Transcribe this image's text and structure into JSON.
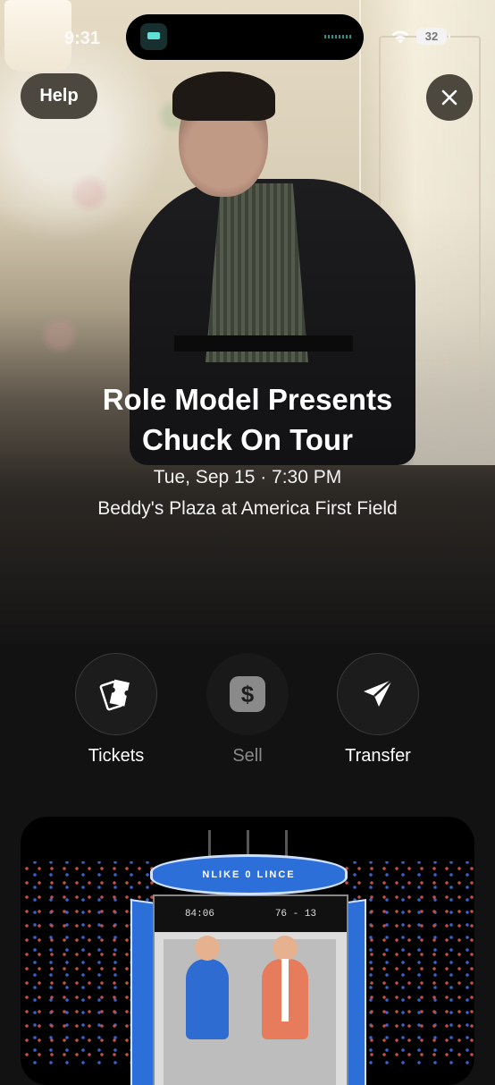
{
  "status_bar": {
    "time": "9:31",
    "battery": "32"
  },
  "header": {
    "help_label": "Help",
    "close_icon": "close-icon"
  },
  "event": {
    "title_line1": "Role Model Presents",
    "title_line2": "Chuck On Tour",
    "datetime": "Tue, Sep 15 · 7:30 PM",
    "venue": "Beddy's Plaza at America First Field"
  },
  "actions": [
    {
      "label": "Tickets",
      "icon": "tickets-icon",
      "enabled": true
    },
    {
      "label": "Sell",
      "icon": "dollar-icon",
      "enabled": false
    },
    {
      "label": "Transfer",
      "icon": "send-icon",
      "enabled": true
    }
  ],
  "promo": {
    "scoreboard_text": "NLIKE 0 LINCE",
    "ticker_center": "84:06",
    "ticker_score": "76 - 13"
  },
  "colors": {
    "accent_blue": "#2d6fd9",
    "accent_red": "#d9594b"
  }
}
